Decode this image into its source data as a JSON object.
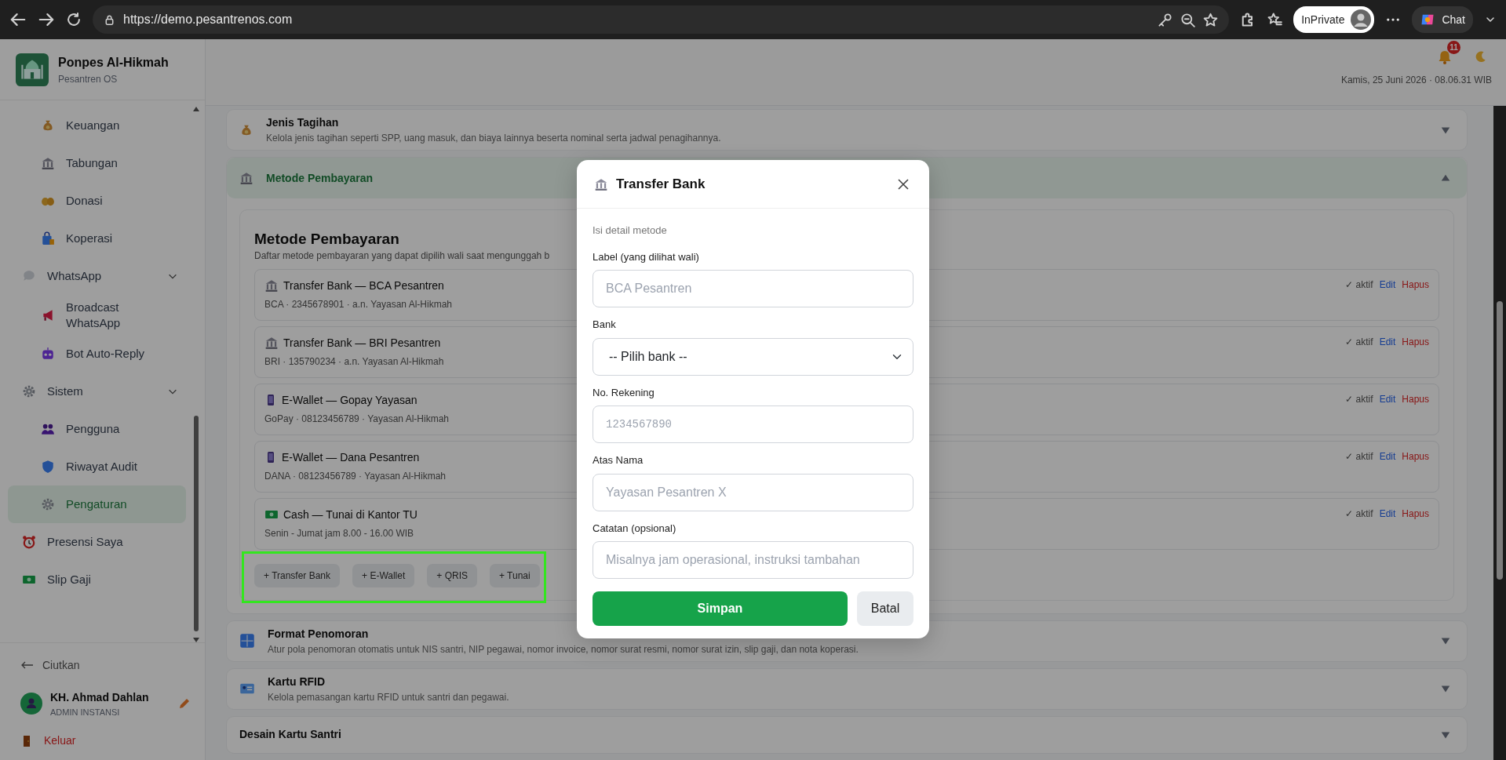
{
  "browser": {
    "url": "https://demo.pesantrenos.com",
    "profile_label": "InPrivate",
    "chat_label": "Chat"
  },
  "sidebar": {
    "brand": {
      "name": "Ponpes Al-Hikmah",
      "subtitle": "Pesantren OS"
    },
    "items": [
      {
        "children": [
          {
            "label": "Keuangan",
            "selected": false
          },
          {
            "label": "Tabungan",
            "selected": false
          },
          {
            "label": "Donasi",
            "selected": false
          },
          {
            "label": "Koperasi",
            "selected": false
          }
        ]
      },
      {
        "label": "WhatsApp",
        "expanded": true,
        "selected": false,
        "children": [
          {
            "label": "Broadcast WhatsApp",
            "selected": false
          },
          {
            "label": "Bot Auto-Reply",
            "selected": false
          }
        ]
      },
      {
        "label": "Sistem",
        "expanded": true,
        "selected": false,
        "children": [
          {
            "label": "Pengguna",
            "selected": false
          },
          {
            "label": "Riwayat Audit",
            "selected": false
          },
          {
            "label": "Pengaturan",
            "selected": true
          }
        ]
      },
      {
        "label": "Presensi Saya",
        "selected": false
      },
      {
        "label": "Slip Gaji",
        "selected": false
      }
    ],
    "collapse_label": "Ciutkan",
    "user": {
      "name": "KH. Ahmad Dahlan",
      "role": "ADMIN INSTANSI"
    },
    "logout_label": "Keluar"
  },
  "header": {
    "notification_count": "11",
    "datetime": "Kamis, 25 Juni 2026 · 08.06.31 WIB"
  },
  "sections": [
    {
      "title": "Jenis Tagihan",
      "description": "Kelola jenis tagihan seperti SPP, uang masuk, dan biaya lainnya beserta nominal serta jadwal penagihannya.",
      "expanded": false
    },
    {
      "title": "Metode Pembayaran",
      "expanded": true,
      "panel": {
        "title": "Metode Pembayaran",
        "description": "Daftar metode pembayaran yang dapat dipilih wali saat mengunggah b",
        "methods": [
          {
            "kind": "bank",
            "title": "Transfer Bank — BCA Pesantren",
            "detail": "BCA · 2345678901 · a.n. Yayasan Al-Hikmah",
            "status": "✓ aktif",
            "edit": "Edit",
            "delete": "Hapus"
          },
          {
            "kind": "bank",
            "title": "Transfer Bank — BRI Pesantren",
            "detail": "BRI · 135790234 · a.n. Yayasan Al-Hikmah",
            "status": "✓ aktif",
            "edit": "Edit",
            "delete": "Hapus"
          },
          {
            "kind": "ewallet",
            "title": "E-Wallet — Gopay Yayasan",
            "detail": "GoPay · 08123456789 · Yayasan Al-Hikmah",
            "status": "✓ aktif",
            "edit": "Edit",
            "delete": "Hapus"
          },
          {
            "kind": "ewallet",
            "title": "E-Wallet — Dana Pesantren",
            "detail": "DANA · 08123456789 · Yayasan Al-Hikmah",
            "status": "✓ aktif",
            "edit": "Edit",
            "delete": "Hapus"
          },
          {
            "kind": "cash",
            "title": "Cash — Tunai di Kantor TU",
            "detail": "Senin - Jumat jam 8.00 - 16.00 WIB",
            "status": "✓ aktif",
            "edit": "Edit",
            "delete": "Hapus"
          }
        ],
        "add_buttons": [
          "+ Transfer Bank",
          "+ E-Wallet",
          "+ QRIS",
          "+ Tunai"
        ]
      }
    },
    {
      "title": "Format Penomoran",
      "description": "Atur pola penomoran otomatis untuk NIS santri, NIP pegawai, nomor invoice, nomor surat resmi, nomor surat izin, slip gaji, dan nota koperasi.",
      "expanded": false
    },
    {
      "title": "Kartu RFID",
      "description": "Kelola pemasangan kartu RFID untuk santri dan pegawai.",
      "expanded": false
    },
    {
      "title": "Desain Kartu Santri",
      "expanded": false
    }
  ],
  "modal": {
    "title": "Transfer Bank",
    "subtitle": "Isi detail metode",
    "fields": [
      {
        "kind": "text",
        "label": "Label (yang dilihat wali)",
        "placeholder": "BCA Pesantren"
      },
      {
        "kind": "select",
        "label": "Bank",
        "value": "-- Pilih bank --"
      },
      {
        "kind": "number",
        "label": "No. Rekening",
        "placeholder": "1234567890"
      },
      {
        "kind": "text",
        "label": "Atas Nama",
        "placeholder": "Yayasan Pesantren X"
      },
      {
        "kind": "text",
        "label": "Catatan (opsional)",
        "placeholder": "Misalnya jam operasional, instruksi tambahan"
      }
    ],
    "save_label": "Simpan",
    "cancel_label": "Batal"
  }
}
